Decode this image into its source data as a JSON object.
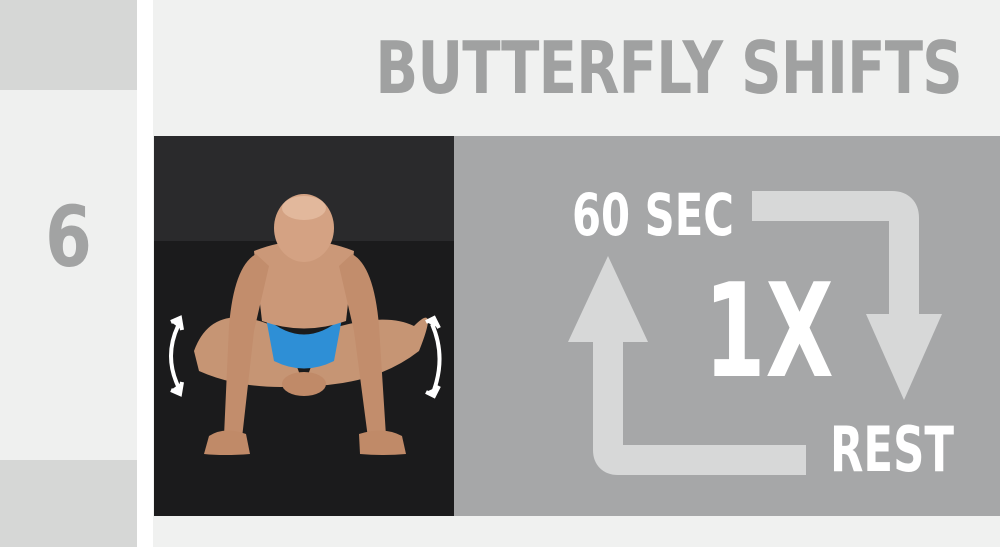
{
  "exercise": {
    "number": "6",
    "title": "BUTTERFLY SHIFTS"
  },
  "timer": {
    "duration": "60 SEC",
    "reps": "1X",
    "rest": "REST"
  },
  "colors": {
    "background": "#f0f1f0",
    "sidebar_accent": "#d6d7d6",
    "text_gray": "#a0a1a1",
    "panel": "#a6a7a8",
    "arrow": "#d7d8d8",
    "photo_background": "#1c1c1d"
  },
  "icons": [
    "rotate-arrow-left-icon",
    "rotate-arrow-right-icon",
    "cycle-arrow-icon"
  ]
}
